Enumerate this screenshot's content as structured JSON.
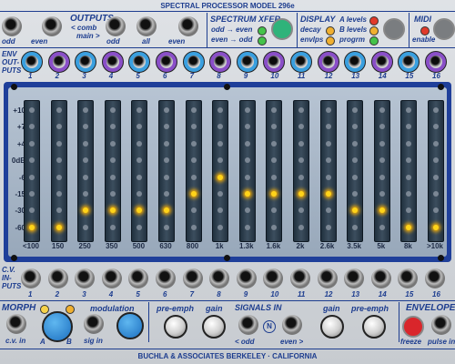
{
  "header": {
    "model": "SPECTRAL PROCESSOR MODEL 296e"
  },
  "outputs": {
    "title": "OUTPUTS",
    "comb": "< comb",
    "main": "main >",
    "jacks": [
      "odd",
      "even",
      "odd",
      "all",
      "even"
    ]
  },
  "spectrum_xfer": {
    "title": "SPECTRUM XFER",
    "odd_even": "odd → even",
    "even_odd": "even → odd"
  },
  "display": {
    "title": "DISPLAY",
    "items": [
      "decay",
      "envlps"
    ],
    "levels": [
      "A levels",
      "B levels",
      "progrm"
    ]
  },
  "midi": {
    "title": "MIDI",
    "enable": "enable"
  },
  "env_outputs": {
    "label1": "ENV",
    "label2": "OUT-",
    "label3": "PUTS",
    "colors": [
      "#3aa0e0",
      "#8a4fc8",
      "#3aa0e0",
      "#8a4fc8",
      "#3aa0e0",
      "#8a4fc8",
      "#3aa0e0",
      "#8a4fc8",
      "#3aa0e0",
      "#8a4fc8",
      "#3aa0e0",
      "#8a4fc8",
      "#3aa0e0",
      "#8a4fc8",
      "#3aa0e0",
      "#8a4fc8"
    ]
  },
  "channel_numbers": [
    "1",
    "2",
    "3",
    "4",
    "5",
    "6",
    "7",
    "8",
    "9",
    "10",
    "11",
    "12",
    "13",
    "14",
    "15",
    "16"
  ],
  "scale": [
    "+10",
    "+7",
    "+4",
    "0dB",
    "-6",
    "-15",
    "-30",
    "-60"
  ],
  "bands": [
    "<100",
    "150",
    "250",
    "350",
    "500",
    "630",
    "800",
    "1k",
    "1.3k",
    "1.6k",
    "2k",
    "2.6k",
    "3.5k",
    "5k",
    "8k",
    ">10k"
  ],
  "levels": [
    7,
    7,
    6,
    6,
    6,
    6,
    5,
    4,
    5,
    5,
    5,
    5,
    6,
    6,
    7,
    7
  ],
  "cv_inputs": {
    "label1": "C.V.",
    "label2": "IN-",
    "label3": "PUTS"
  },
  "bottom": {
    "morph": "MORPH",
    "cv_in": "c.v. in",
    "a": "A",
    "b": "B",
    "modulation": "modulation",
    "sig_in": "sig in",
    "pre_emph": "pre-emph",
    "gain": "gain",
    "signals_in": "SIGNALS IN",
    "odd": "< odd",
    "n": "N",
    "even": "even >",
    "gain2": "gain",
    "pre_emph2": "pre-emph",
    "envelope": "ENVELOPE",
    "freeze": "freeze",
    "pulse_in": "pulse in"
  },
  "footer": {
    "maker": "BUCHLA & ASSOCIATES    BERKELEY · CALIFORNIA"
  },
  "colors": {
    "panel_blue": "#1d3d8f",
    "meter_frame": "#1f3f9a",
    "led_on": "#ffd41a",
    "jack_blue": "#3aa0e0",
    "jack_purple": "#8a4fc8",
    "button_green": "#2fb37a",
    "button_grey": "#7a7d80",
    "button_red": "#d9262b"
  }
}
